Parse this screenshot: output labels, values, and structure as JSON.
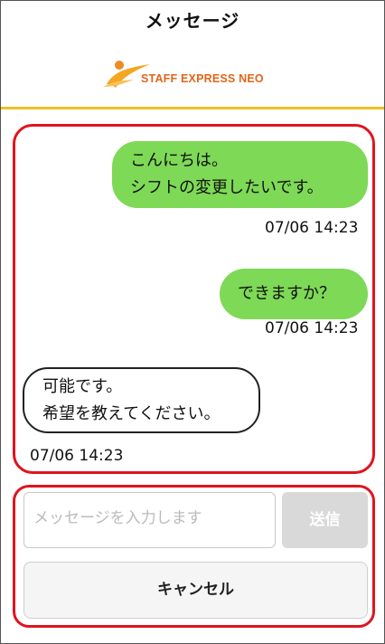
{
  "header": {
    "title": "メッセージ",
    "logo_text": "STAFF EXPRESS NEO",
    "accent_color": "#f0c020"
  },
  "messages": [
    {
      "direction": "outgoing",
      "lines": [
        "こんにちは。",
        "シフトの変更したいです。"
      ],
      "time": "07/06 14:23"
    },
    {
      "direction": "outgoing",
      "lines": [
        "できますか？"
      ],
      "time": "07/06 14:23"
    },
    {
      "direction": "incoming",
      "lines": [
        "可能です。",
        "希望を教えてください。"
      ],
      "time": "07/06 14:23"
    }
  ],
  "composer": {
    "placeholder": "メッセージを入力します",
    "send_label": "送信",
    "cancel_label": "キャンセル"
  },
  "colors": {
    "outgoing_bubble": "#7ed957",
    "highlight_border": "#e0141e"
  }
}
